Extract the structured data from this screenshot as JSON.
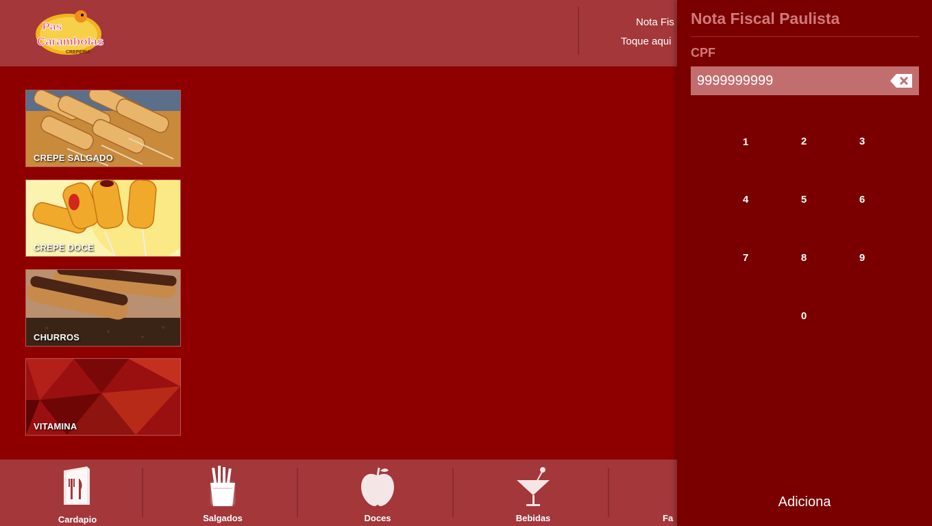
{
  "header": {
    "logo": {
      "line1": "Pas",
      "line2": "Carambolas",
      "line3": "CREPERIA",
      "icon": "carambola-mascot-logo"
    },
    "nfp_line1": "Nota Fis",
    "nfp_line2": "Toque aqui"
  },
  "categories": [
    {
      "label": "CREPE SALGADO",
      "image": "savory-crepe-photo"
    },
    {
      "label": "CREPE DOCE",
      "image": "sweet-crepe-photo"
    },
    {
      "label": "CHURROS",
      "image": "churros-photo"
    },
    {
      "label": "VITAMINA",
      "image": "red-geometric-pattern"
    }
  ],
  "bottom_nav": [
    {
      "label": "Cardapio",
      "icon": "menu-book-icon"
    },
    {
      "label": "Salgados",
      "icon": "fries-icon"
    },
    {
      "label": "Doces",
      "icon": "apple-icon"
    },
    {
      "label": "Bebidas",
      "icon": "cocktail-icon"
    },
    {
      "label": "Fa",
      "icon": "cocktail-icon"
    }
  ],
  "panel": {
    "title": "Nota Fiscal Paulista",
    "cpf_label": "CPF",
    "cpf_value": "9999999999",
    "keys": [
      "1",
      "2",
      "3",
      "4",
      "5",
      "6",
      "7",
      "8",
      "9",
      "0"
    ],
    "submit_label": "Adiciona"
  },
  "colors": {
    "background": "#8e0000",
    "header": "#a3373a",
    "panel": "#7a0000",
    "panel_text_muted": "#d07a7a",
    "input_bg": "#c26e6e"
  }
}
